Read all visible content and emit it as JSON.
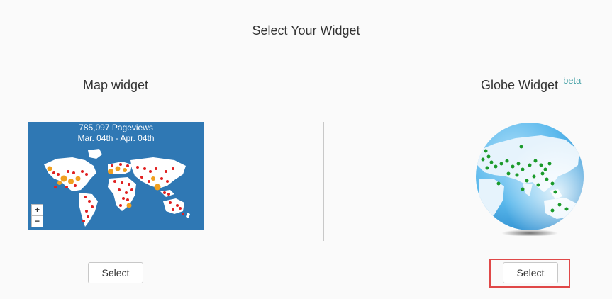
{
  "header": {
    "title": "Select Your Widget"
  },
  "map_widget": {
    "title": "Map widget",
    "pageviews": "785,097 Pageviews",
    "date_range": "Mar. 04th - Apr. 04th",
    "zoom_in_label": "+",
    "zoom_out_label": "−",
    "select_label": "Select",
    "colors": {
      "ocean": "#2f78b4",
      "land": "#ffffff",
      "dot_red": "#e02020",
      "dot_orange": "#f0a020"
    }
  },
  "globe_widget": {
    "title": "Globe Widget",
    "badge": "beta",
    "select_label": "Select",
    "colors": {
      "ocean": "#5ab8ec",
      "land": "#e6f3fc",
      "dot_green": "#1a9a2a"
    }
  },
  "highlight": {
    "target": "globe-select-button",
    "color": "#e04848"
  }
}
